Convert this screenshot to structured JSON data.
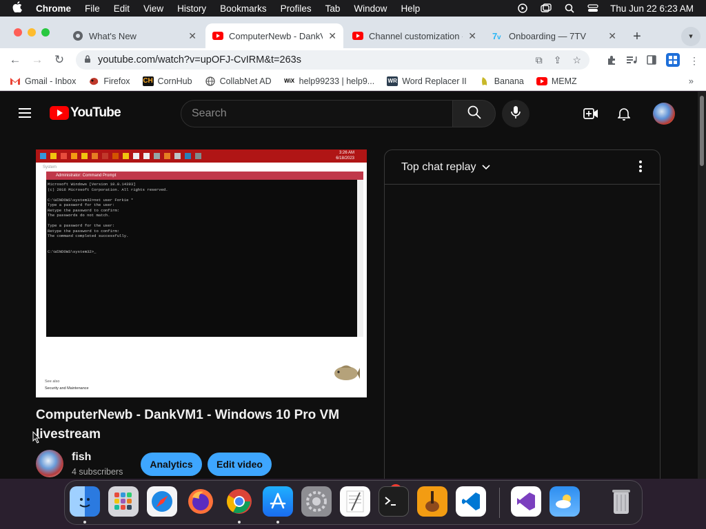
{
  "menubar": {
    "app_name": "Chrome",
    "items": [
      "File",
      "Edit",
      "View",
      "History",
      "Bookmarks",
      "Profiles",
      "Tab",
      "Window",
      "Help"
    ],
    "datetime": "Thu Jun 22  6:23 AM"
  },
  "tabs": [
    {
      "title": "What's New",
      "icon": "chrome-icon"
    },
    {
      "title": "ComputerNewb - DankV",
      "icon": "youtube-icon",
      "active": true
    },
    {
      "title": "Channel customization -",
      "icon": "youtube-icon"
    },
    {
      "title": "Onboarding — 7TV",
      "icon": "7tv-icon"
    }
  ],
  "omnibox": {
    "url": "youtube.com/watch?v=upOFJ-CvIRM&t=263s"
  },
  "bookmarks": [
    {
      "label": "Gmail - Inbox",
      "icon": "gmail-icon",
      "color": "#ea4335"
    },
    {
      "label": "Firefox",
      "icon": "firefox-icon",
      "color": "#c0392b"
    },
    {
      "label": "CornHub",
      "icon": "ch-icon",
      "color": "#111111"
    },
    {
      "label": "CollabNet AD",
      "icon": "globe-icon",
      "color": "#555555"
    },
    {
      "label": "help99233 | help9...",
      "icon": "wix-icon",
      "color": "#000000"
    },
    {
      "label": "Word Replacer II",
      "icon": "wr-icon",
      "color": "#2c3e50"
    },
    {
      "label": "Banana",
      "icon": "banana-icon",
      "color": "#f1c40f"
    },
    {
      "label": "MEMZ",
      "icon": "youtube-icon",
      "color": "#ff0000"
    }
  ],
  "youtube": {
    "logo_text": "YouTube",
    "search_placeholder": "Search",
    "video": {
      "clock_time": "3:26 AM",
      "clock_date": "6/18/2023",
      "system_label": "System",
      "cmd_title": "Administrator: Command Prompt",
      "cmd_text": "Microsoft Windows [Version 10.0.14393]\n(c) 2016 Microsoft Corporation. All rights reserved.\n\nC:\\WINDOWS\\system32>net user Forkie *\nType a password for the user:\nRetype the password to confirm:\nThe passwords do not match.\n\nType a password for the user:\nRetype the password to confirm:\nThe command completed successfully.\n\n\nC:\\WINDOWS\\system32>_",
      "see_also": "See also",
      "security_link": "Security and Maintenance"
    },
    "title": "ComputerNewb - DankVM1 - Windows 10 Pro VM livestream",
    "channel": {
      "name": "fish",
      "subscribers": "4 subscribers"
    },
    "buttons": {
      "analytics": "Analytics",
      "edit": "Edit video"
    },
    "chat": {
      "header": "Top chat replay"
    }
  },
  "dock": {
    "apps": [
      "finder-icon",
      "launchpad-icon",
      "safari-icon",
      "firefox-icon",
      "chrome-icon",
      "app-store-icon",
      "system-settings-icon",
      "textedit-icon",
      "terminal-icon",
      "garageband-icon",
      "vscode-icon",
      "visual-studio-icon",
      "weather-icon",
      "trash-icon"
    ],
    "settings_badge": "2"
  }
}
